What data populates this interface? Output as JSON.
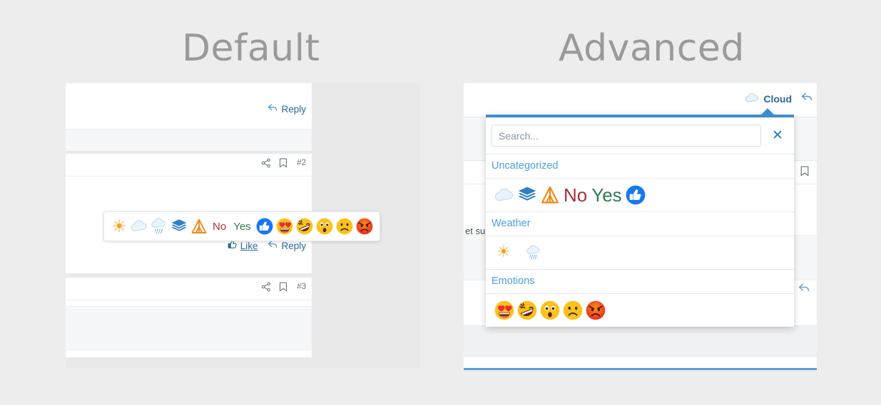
{
  "sections": {
    "default_title": "Default",
    "advanced_title": "Advanced"
  },
  "default_panel": {
    "post_1": {
      "reply_label": "Reply"
    },
    "post_2": {
      "share_icon": "share-icon",
      "bookmark_icon": "bookmark-icon",
      "post_number": "#2",
      "like_label": "Like",
      "reply_label": "Reply"
    },
    "post_3": {
      "share_icon": "share-icon",
      "bookmark_icon": "bookmark-icon",
      "post_number": "#3"
    },
    "reaction_bar": {
      "items": [
        {
          "name": "sun",
          "kind": "glyph",
          "glyph": "☀",
          "color": "#f5a623"
        },
        {
          "name": "cloud",
          "kind": "svg-cloud",
          "glyph": "",
          "color": "#d8e7f2"
        },
        {
          "name": "rain-cloud",
          "kind": "svg-rain",
          "glyph": "",
          "color": "#cfe3f0"
        },
        {
          "name": "layers",
          "kind": "svg-layers",
          "glyph": "",
          "color": "#2f7fc4"
        },
        {
          "name": "tent",
          "kind": "svg-tent",
          "glyph": "",
          "color": "#e88b1e"
        },
        {
          "name": "no",
          "kind": "word",
          "glyph": "No",
          "color": "#a8303c"
        },
        {
          "name": "yes",
          "kind": "word",
          "glyph": "Yes",
          "color": "#2e7d4f"
        },
        {
          "name": "thumbs-up",
          "kind": "svg-thumb",
          "glyph": "",
          "color": "#1877f2"
        },
        {
          "name": "heart-eyes",
          "kind": "svg-face-love",
          "glyph": "",
          "color": "#fbc02d"
        },
        {
          "name": "rofl",
          "kind": "svg-face-rofl",
          "glyph": "",
          "color": "#fbc02d"
        },
        {
          "name": "astonished",
          "kind": "svg-face-shock",
          "glyph": "",
          "color": "#fbc02d"
        },
        {
          "name": "frowning",
          "kind": "svg-face-frown",
          "glyph": "",
          "color": "#fbc02d"
        },
        {
          "name": "angry",
          "kind": "svg-face-angry",
          "glyph": "",
          "color": "#e8401f"
        }
      ]
    }
  },
  "advanced_panel": {
    "header": {
      "cloud_reaction_label": "Cloud",
      "reply_icon": "reply-arrow-icon"
    },
    "post_head": {
      "share_icon": "share-icon",
      "bookmark_icon": "bookmark-icon"
    },
    "text_fragment": "et sun",
    "picker": {
      "search_placeholder": "Search...",
      "search_value": "",
      "close_icon": "close-icon",
      "categories": [
        {
          "label": "Uncategorized",
          "items": [
            {
              "name": "cloud",
              "kind": "svg-cloud",
              "glyph": ""
            },
            {
              "name": "layers",
              "kind": "svg-layers",
              "glyph": ""
            },
            {
              "name": "tent",
              "kind": "svg-tent",
              "glyph": ""
            },
            {
              "name": "no",
              "kind": "word",
              "glyph": "No",
              "color": "#a8303c"
            },
            {
              "name": "yes",
              "kind": "word",
              "glyph": "Yes",
              "color": "#2e7d4f"
            },
            {
              "name": "thumbs-up",
              "kind": "svg-thumb",
              "glyph": ""
            }
          ]
        },
        {
          "label": "Weather",
          "items": [
            {
              "name": "sun",
              "kind": "glyph",
              "glyph": "☀",
              "color": "#f5a623"
            },
            {
              "name": "rain-cloud",
              "kind": "svg-rain",
              "glyph": ""
            }
          ]
        },
        {
          "label": "Emotions",
          "items": [
            {
              "name": "heart-eyes",
              "kind": "svg-face-love",
              "glyph": ""
            },
            {
              "name": "rofl",
              "kind": "svg-face-rofl",
              "glyph": ""
            },
            {
              "name": "astonished",
              "kind": "svg-face-shock",
              "glyph": ""
            },
            {
              "name": "frowning",
              "kind": "svg-face-frown",
              "glyph": ""
            },
            {
              "name": "angry",
              "kind": "svg-face-angry",
              "glyph": ""
            }
          ]
        }
      ]
    }
  },
  "colors": {
    "page_bg": "#ededed",
    "accent_blue": "#3d8ece",
    "link_blue": "#2b6a9a",
    "category_blue": "#4da0e0",
    "title_gray": "#9a9a9a"
  }
}
